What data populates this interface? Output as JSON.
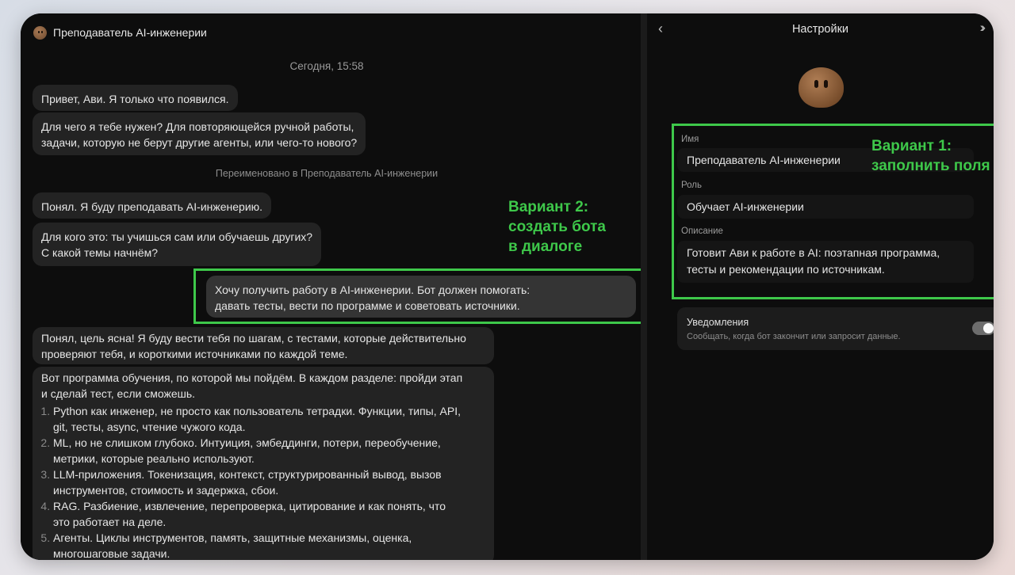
{
  "chat": {
    "title": "Преподаватель AI-инженерии",
    "timestamp": "Сегодня, 15:58",
    "messages": [
      {
        "from": "bot",
        "text": "Привет, Ави. Я только что появился."
      },
      {
        "from": "bot",
        "lines": [
          "Для чего я тебе нужен? Для повторяющейся ручной работы,",
          "задачи, которую не берут другие агенты, или чего-то нового?"
        ]
      },
      {
        "from": "system",
        "text": "Переименовано в Преподаватель AI-инженерии"
      },
      {
        "from": "bot",
        "text": "Понял. Я буду преподавать AI-инженерию."
      },
      {
        "from": "bot",
        "lines": [
          "Для кого это: ты учишься сам или обучаешь других?",
          "С какой темы начнём?"
        ]
      },
      {
        "from": "user",
        "lines": [
          "Хочу получить работу в AI-инженерии. Бот должен помогать:",
          "давать тесты, вести по программе и советовать источники."
        ]
      },
      {
        "from": "bot",
        "lines": [
          "Понял, цель ясна! Я буду вести тебя по шагам, с тестами, которые действительно",
          "проверяют тебя, и короткими источниками по каждой теме."
        ]
      },
      {
        "from": "bot",
        "lines": [
          "Вот программа обучения, по которой мы пойдём. В каждом разделе: пройди этап",
          "и сделай тест, если сможешь."
        ],
        "list": [
          [
            "Python как инженер, не просто как пользователь тетрадки. Функции, типы, API,",
            "git, тесты, async, чтение чужого кода."
          ],
          [
            "ML, но не слишком глубоко. Интуиция, эмбеддинги, потери, переобучение,",
            "метрики, которые реально используют."
          ],
          [
            "LLM-приложения. Токенизация, контекст, структурированный вывод, вызов",
            "инструментов, стоимость и задержка, сбои."
          ],
          [
            "RAG. Разбиение, извлечение, перепроверка, цитирование и как понять, что",
            "это работает на деле."
          ],
          [
            "Агенты. Циклы инструментов, память, защитные механизмы, оценка,",
            "многошаговые задачи."
          ]
        ]
      }
    ]
  },
  "annotations": {
    "variant2": [
      "Вариант 2:",
      "создать бота",
      "в диалоге"
    ],
    "variant1": [
      "Вариант 1:",
      "заполнить поля"
    ],
    "color": "#3ec84a"
  },
  "settings": {
    "back_icon": "chevron-left-icon",
    "title": "Настройки",
    "collapse_icon": "double-chevron-right-icon",
    "fields": [
      {
        "label": "Имя",
        "value": "Преподаватель AI-инженерии"
      },
      {
        "label": "Роль",
        "value": "Обучает AI-инженерии"
      },
      {
        "label": "Описание",
        "lines": [
          "Готовит Ави к работе в AI: поэтапная программа,",
          "тесты и рекомендации по источникам."
        ]
      }
    ],
    "notifications": {
      "title": "Уведомления",
      "description": "Сообщать, когда бот закончит или запросит данные.",
      "enabled": true
    }
  }
}
